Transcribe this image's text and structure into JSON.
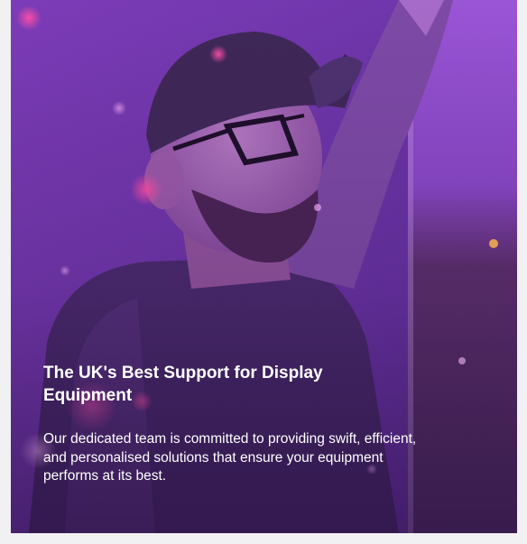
{
  "hero": {
    "heading": "The UK's Best Support for Display Equipment",
    "body": "Our dedicated team is committed to providing swift, efficient, and personalised solutions that ensure your equipment performs at its best."
  },
  "colors": {
    "page_background": "#f1f0f2",
    "overlay": "#6d36a8",
    "text": "#ffffff"
  }
}
